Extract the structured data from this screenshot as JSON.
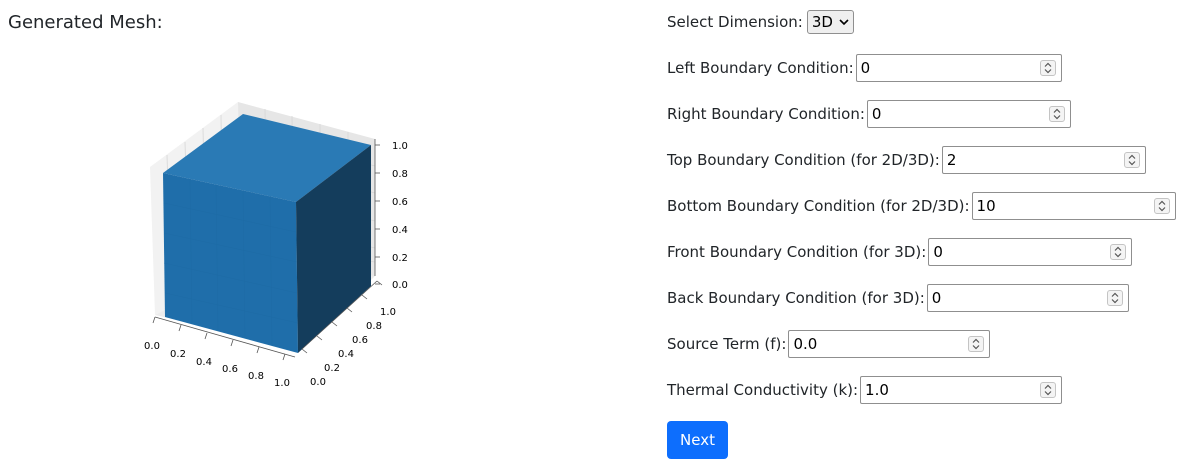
{
  "mesh": {
    "title": "Generated Mesh:",
    "x_ticks": [
      "0.0",
      "0.2",
      "0.4",
      "0.6",
      "0.8",
      "1.0"
    ],
    "y_ticks": [
      "0.0",
      "0.2",
      "0.4",
      "0.6",
      "0.8",
      "1.0"
    ],
    "z_ticks": [
      "0.0",
      "0.2",
      "0.4",
      "0.6",
      "0.8",
      "1.0"
    ],
    "cube_color": "#1f77b4"
  },
  "form": {
    "dimension_label": "Select Dimension:",
    "dimension_value": "3D",
    "fields": [
      {
        "label": "Left Boundary Condition:",
        "value": "0"
      },
      {
        "label": "Right Boundary Condition:",
        "value": "0"
      },
      {
        "label": "Top Boundary Condition (for 2D/3D):",
        "value": "2"
      },
      {
        "label": "Bottom Boundary Condition (for 2D/3D):",
        "value": "10"
      },
      {
        "label": "Front Boundary Condition (for 3D):",
        "value": "0"
      },
      {
        "label": "Back Boundary Condition (for 3D):",
        "value": "0"
      },
      {
        "label": "Source Term (f):",
        "value": "0.0"
      },
      {
        "label": "Thermal Conductivity (k):",
        "value": "1.0"
      }
    ],
    "next_label": "Next",
    "accent_color": "#0d6efd"
  }
}
